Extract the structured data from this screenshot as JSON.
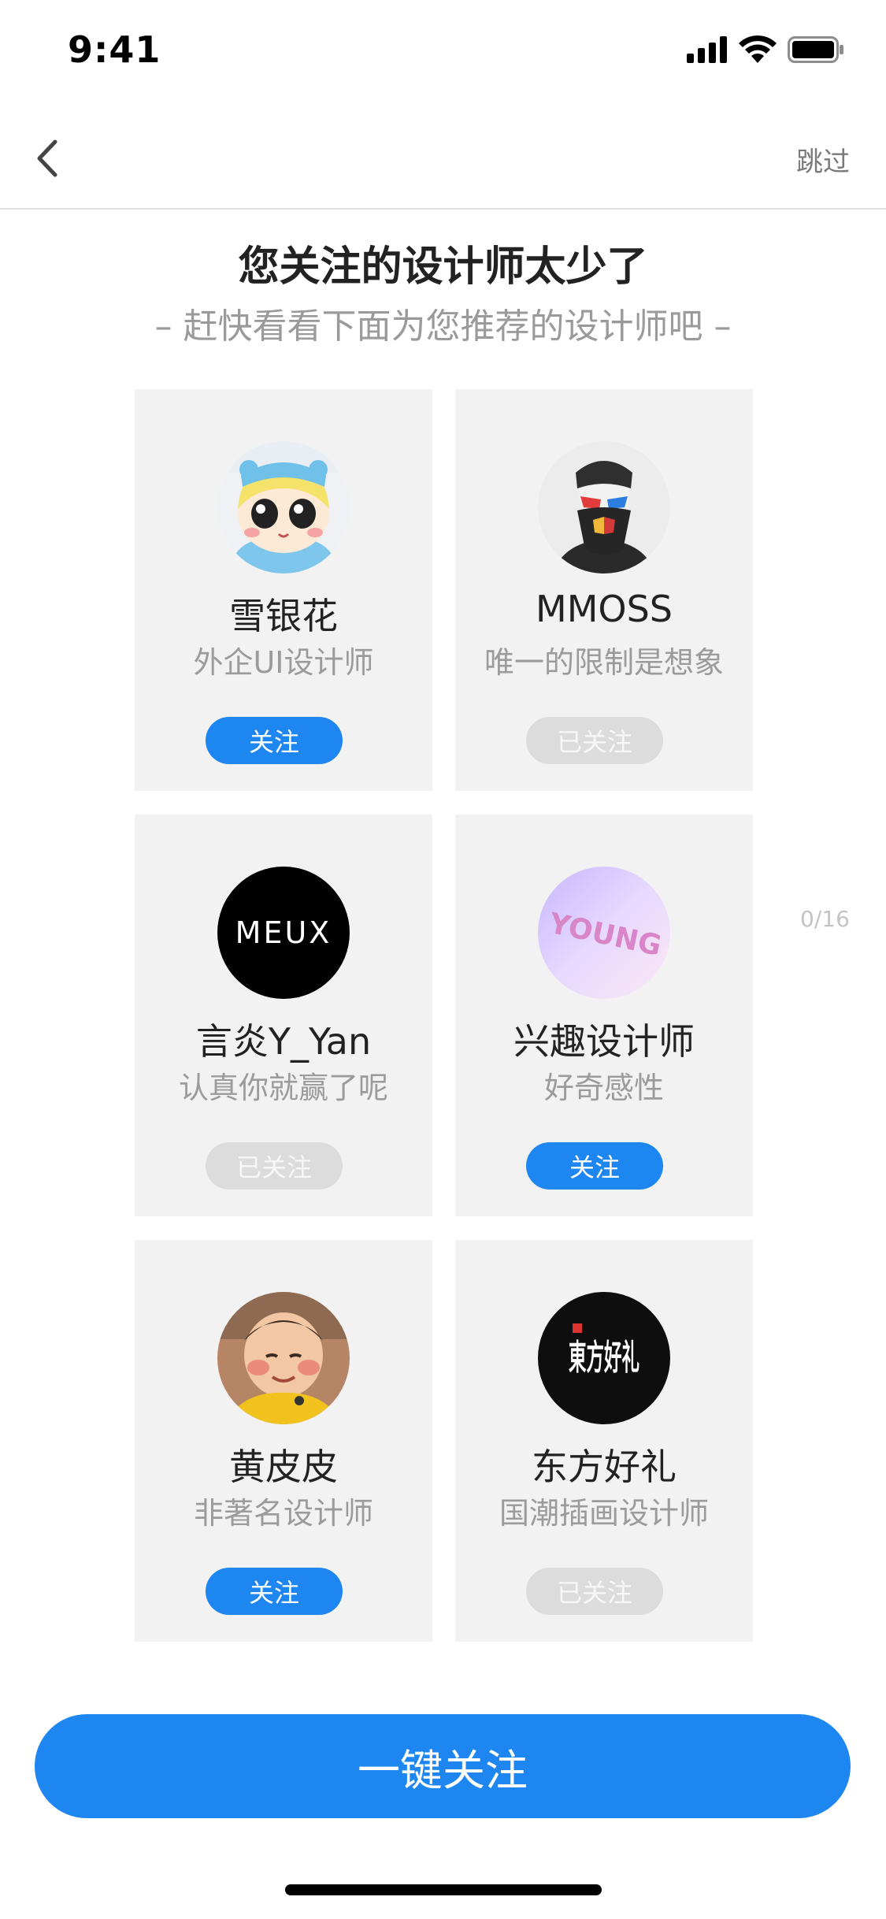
{
  "status_bar": {
    "time": "9:41"
  },
  "nav": {
    "skip_label": "跳过"
  },
  "header": {
    "title": "您关注的设计师太少了",
    "subtitle": "– 赶快看看下面为您推荐的设计师吧 –"
  },
  "designers": [
    {
      "name": "雪银花",
      "desc": "外企UI设计师",
      "button_label": "关注",
      "followed": false,
      "avatar": "cartoon-kid-avatar"
    },
    {
      "name": "MMOSS",
      "desc": "唯一的限制是想象",
      "button_label": "已关注",
      "followed": true,
      "avatar": "bearded-man-avatar"
    },
    {
      "name": "言炎Y_Yan",
      "desc": "认真你就赢了呢",
      "button_label": "已关注",
      "followed": true,
      "avatar": "meux-logo-avatar",
      "avatar_text": "MEUX"
    },
    {
      "name": "兴趣设计师",
      "desc": "好奇感性",
      "button_label": "关注",
      "followed": false,
      "avatar": "young-3d-text-avatar",
      "avatar_text": "YOUNG"
    },
    {
      "name": "黄皮皮",
      "desc": "非著名设计师",
      "button_label": "关注",
      "followed": false,
      "avatar": "baby-photo-avatar"
    },
    {
      "name": "东方好礼",
      "desc": "国潮插画设计师",
      "button_label": "已关注",
      "followed": true,
      "avatar": "calligraphy-logo-avatar",
      "avatar_text": "東方好礼"
    }
  ],
  "page_counter": "0/16",
  "cta": {
    "label": "一键关注"
  },
  "colors": {
    "accent": "#1e86f0",
    "card_bg": "#f2f2f2",
    "followed_bg": "#dcdcdc"
  }
}
